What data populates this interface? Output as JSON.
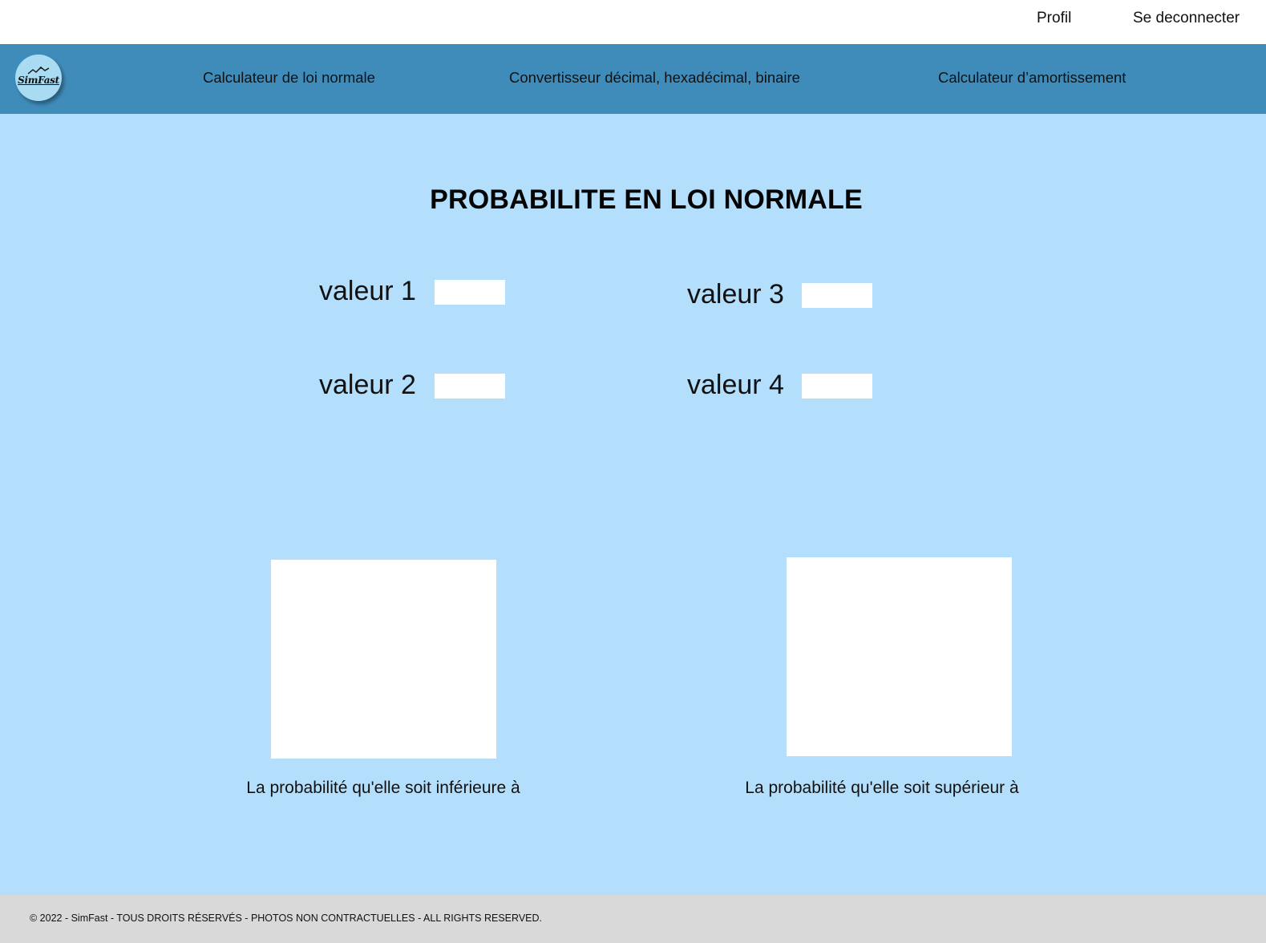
{
  "topbar": {
    "profile_label": "Profil",
    "logout_label": "Se deconnecter"
  },
  "navbar": {
    "logo_text": "SimFast",
    "items": [
      {
        "label": "Calculateur de loi normale"
      },
      {
        "label": "Convertisseur décimal, hexadécimal, binaire"
      },
      {
        "label": "Calculateur d’amortissement"
      }
    ]
  },
  "main": {
    "title": "PROBABILITE EN LOI NORMALE",
    "fields": [
      {
        "label": "valeur 1",
        "value": ""
      },
      {
        "label": "valeur 2",
        "value": ""
      },
      {
        "label": "valeur 3",
        "value": ""
      },
      {
        "label": "valeur 4",
        "value": ""
      }
    ],
    "results": [
      {
        "caption": "La probabilité qu'elle soit inférieure à"
      },
      {
        "caption": "La probabilité qu'elle soit supérieur à"
      }
    ]
  },
  "footer": {
    "text": "© 2022 - SimFast - TOUS DROITS RÉSERVÉS - PHOTOS NON CONTRACTUELLES - ALL RIGHTS RESERVED."
  },
  "colors": {
    "page_background": "#b4dffc",
    "navbar_background": "#3f8cbb",
    "footer_background": "#d9d9d9",
    "topbar_background": "#ffffff",
    "logo_background": "#a9dcf2"
  }
}
